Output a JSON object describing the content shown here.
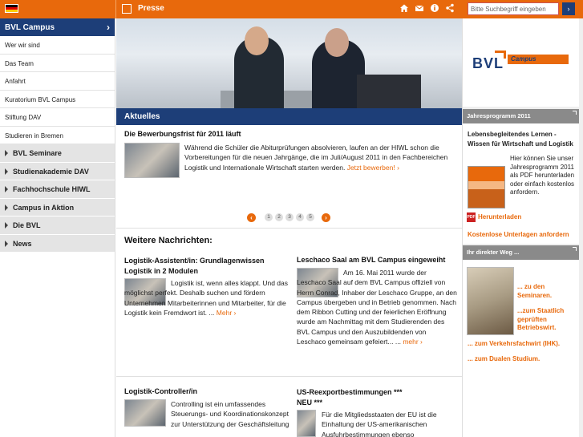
{
  "header": {
    "section_label": "Presse",
    "search_placeholder": "Bitte Suchbegriff eingeben",
    "search_button": "›",
    "icons": [
      "home-icon",
      "mail-icon",
      "info-icon",
      "share-icon"
    ]
  },
  "sidebar": {
    "title": "BVL Campus",
    "title_chevron": "›",
    "sub_items": [
      "Wer wir sind",
      "Das Team",
      "Anfahrt",
      "Kuratorium BVL Campus",
      "Stiftung DAV",
      "Studieren in Bremen"
    ],
    "main_items": [
      "BVL Seminare",
      "Studienakademie DAV",
      "Fachhochschule HIWL",
      "Campus in Aktion",
      "Die BVL",
      "News"
    ]
  },
  "aktuelles": {
    "title": "Aktuelles",
    "headline": "Die Bewerbungsfrist für 2011 läuft",
    "text": "Während die Schüler die Abiturprüfungen absolvieren, laufen an der HIWL schon die Vorbereitungen für die neuen Jahrgänge, die im Juli/August 2011 in den Fachbereichen Logistik und Internationale Wirtschaft starten werden.",
    "more": "Jetzt bewerben! ›",
    "pager": [
      "1",
      "2",
      "3",
      "4",
      "5"
    ],
    "prev": "‹",
    "next": "›"
  },
  "weitere": {
    "title": "Weitere Nachrichten:",
    "items": [
      {
        "headline": "Logistik-Assistent/in: Grundlagenwissen Logistik in 2 Modulen",
        "text": "Logistik ist, wenn alles klappt. Und das möglichst perfekt. Deshalb suchen und fördern Unternehmen Mitarbeiterinnen und Mitarbeiter, für die Logistik kein Fremdwort ist. ...",
        "more": "Mehr ›"
      },
      {
        "headline": "Leschaco Saal am BVL Campus eingeweiht",
        "text": "Am 16. Mai 2011 wurde der Leschaco Saal auf dem BVL Campus offiziell von Herrn Conrad, Inhaber der Leschaco Gruppe, an den Campus übergeben und in Betrieb genommen. Nach dem Ribbon Cutting und der feierlichen Eröffnung wurde am Nachmittag mit dem Studierenden des BVL Campus und den Auszubildenden von Leschaco gemeinsam gefeiert... ...",
        "more": "mehr ›"
      },
      {
        "headline": "Logistik-Controller/in",
        "text": "Controlling ist ein umfassendes Steuerungs- und Koordinationskonzept zur Unterstützung der Geschäftsleitung"
      },
      {
        "headline": "US-Reexportbestimmungen *** NEU ***",
        "text": "Für die Mitgliedsstaaten der EU ist die Einhaltung der US-amerikanischen Ausfuhrbestimmungen ebenso"
      }
    ]
  },
  "right": {
    "logo_text": "BVL",
    "logo_campus": "Campus",
    "jahres_bar": "Jahresprogramm 2011",
    "jahres_title": "Lebensbegleitendes Lernen - Wissen für Wirtschaft und Logistik",
    "jahres_text": "Hier können Sie unser Jahresprogramm 2011 als PDF herunterladen oder einfach kostenlos anfordern.",
    "pdf_label": "PDF",
    "download_link": "Herunterladen",
    "order_link": "Kostenlose Unterlagen anfordern",
    "weg_bar": "Ihr direkter Weg ...",
    "weg_links": [
      "... zu den Seminaren.",
      "...zum Staatlich geprüften Betriebswirt.",
      "... zum Verkehrsfachwirt (IHK).",
      "... zum Dualen Studium."
    ]
  },
  "colors": {
    "accent": "#e8690c",
    "navy": "#1d3e78",
    "grey": "#8a8a8a"
  }
}
